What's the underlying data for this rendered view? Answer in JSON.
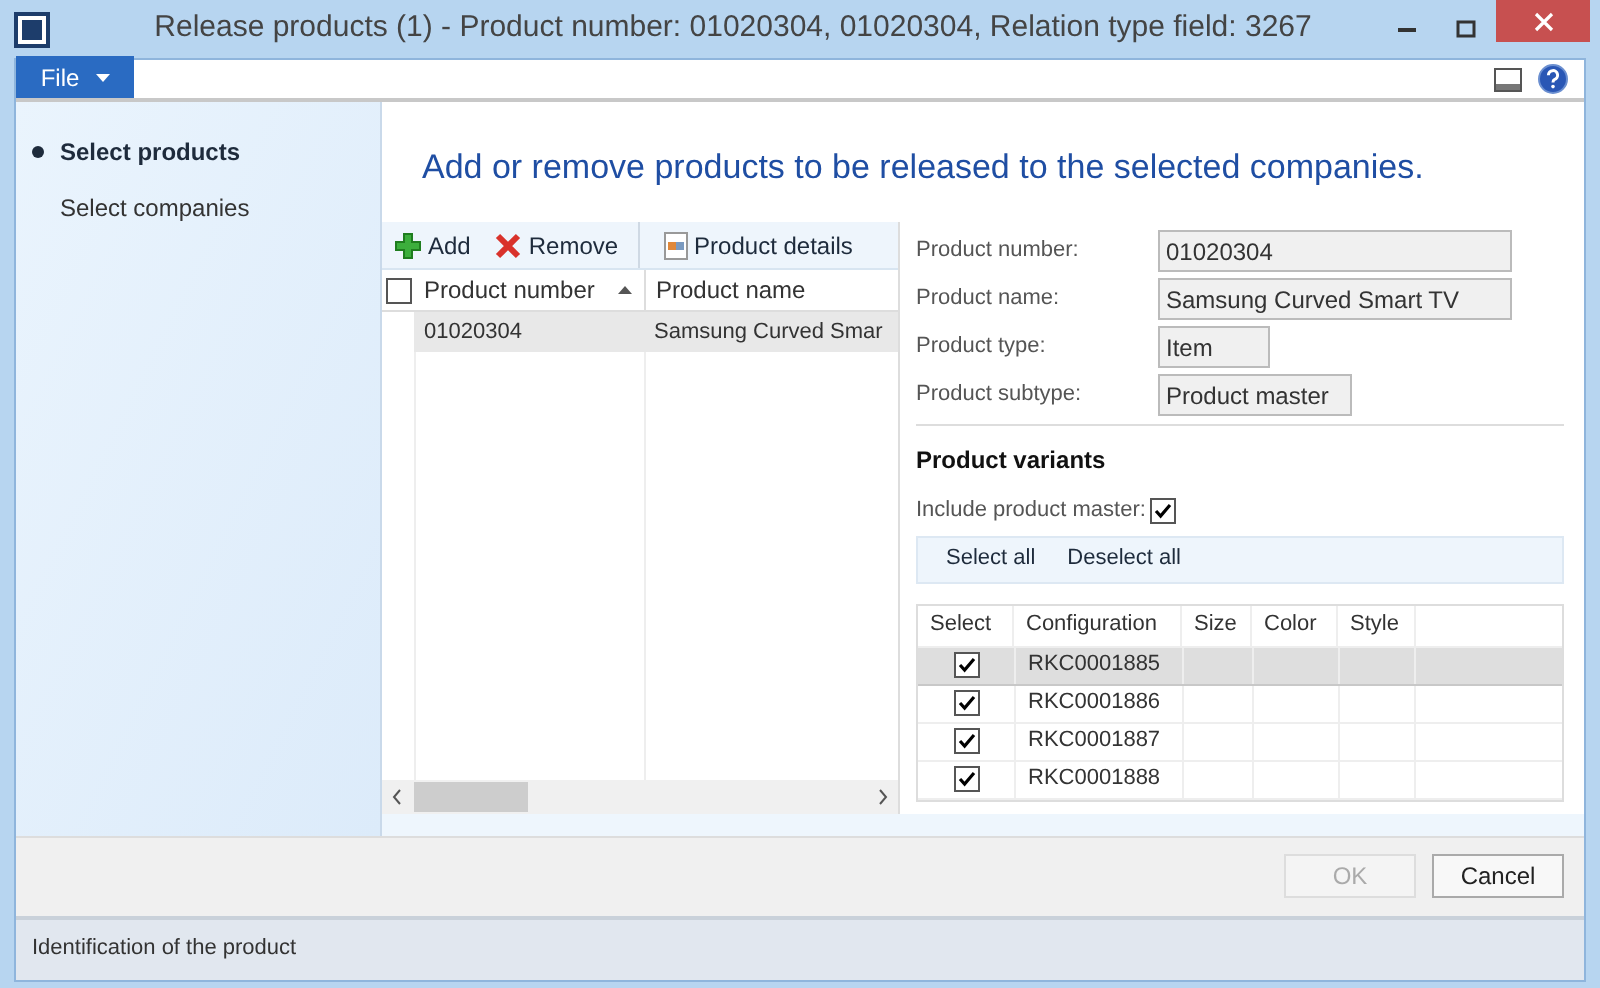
{
  "window": {
    "title": "Release products (1) - Product number: 01020304, 01020304, Relation type field: 3267"
  },
  "file_menu": {
    "label": "File"
  },
  "nav": [
    {
      "label": "Select products",
      "selected": true
    },
    {
      "label": "Select companies",
      "selected": false
    }
  ],
  "heading": "Add or remove products to be released to the selected companies.",
  "toolbar": [
    {
      "label": "Add",
      "kind": "add"
    },
    {
      "label": "Remove",
      "kind": "remove"
    },
    {
      "label": "Product details",
      "kind": "details"
    }
  ],
  "products": {
    "select_all_checked": false,
    "columns": [
      "Product number",
      "Product name"
    ],
    "rows": [
      {
        "cells": [
          "01020304",
          "Samsung Curved Smar"
        ],
        "selected": true
      }
    ]
  },
  "details": [
    {
      "label": "Product number:",
      "value": "01020304"
    },
    {
      "label": "Product name:",
      "value": "Samsung Curved Smart TV"
    },
    {
      "label": "Product type:",
      "value": "Item"
    },
    {
      "label": "Product subtype:",
      "value": "Product master"
    }
  ],
  "variants": {
    "title": "Product variants",
    "include_label": "Include product master:",
    "include_checked": true,
    "actions": [
      "Select all",
      "Deselect all"
    ],
    "columns": [
      "Select",
      "Configuration",
      "Size",
      "Color",
      "Style"
    ],
    "rows": [
      {
        "configuration": "RKC0001885",
        "checked": true,
        "selected": true
      },
      {
        "configuration": "RKC0001886",
        "checked": true,
        "selected": false
      },
      {
        "configuration": "RKC0001887",
        "checked": true,
        "selected": false
      },
      {
        "configuration": "RKC0001888",
        "checked": true,
        "selected": false
      }
    ]
  },
  "buttons": [
    {
      "label": "OK",
      "disabled": true
    },
    {
      "label": "Cancel",
      "disabled": false
    }
  ],
  "status_bar": "Identification of the product"
}
